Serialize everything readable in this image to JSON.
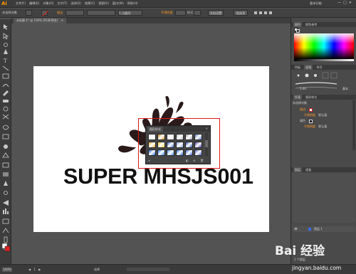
{
  "app": {
    "logo": "Ai",
    "menus": [
      "文件(F)",
      "编辑(E)",
      "对象(O)",
      "文字(T)",
      "选择(S)",
      "效果(C)",
      "视图(V)",
      "窗口(W)",
      "帮助(H)"
    ],
    "workspace": "基本功能",
    "window_controls": [
      "—",
      "□",
      "✕"
    ]
  },
  "control_bar": {
    "selection_label": "未选择对象",
    "stroke_label": "描边",
    "opacity_label": "不透明度",
    "style_label": "样式",
    "doc_setup_button": "文档设置",
    "preferences_button": "首选项",
    "brush_value": "5 点圆形"
  },
  "document_tab": {
    "title": "未标题-1* @ 100% (RGB/预览)",
    "close": "✕"
  },
  "canvas": {
    "headline": "SUPER MHSJS001"
  },
  "graphic_styles_panel": {
    "tab": "图形样式",
    "swatch_colors": [
      "#f2f2f2",
      "#cf8a1a",
      "#e6e6e6",
      "#b8c0c8",
      "#9aa3ad",
      "#5b7fc9",
      "#e6a92a",
      "#ffcc33",
      "#3a62c2",
      "#8aa6e6",
      "#2a4ea8",
      "#4a3fa8",
      "#1f5fd6",
      "#2e7be3",
      "#4b8ff0",
      "#2a6ad6",
      "#3a5fcf",
      "#5060d0"
    ],
    "bottom_icons": [
      "≡",
      "◧",
      "⊕",
      "🗑"
    ]
  },
  "right_dock": {
    "color_header": [
      "颜色",
      "颜色参考"
    ],
    "brush_header": [
      "色板",
      "画笔",
      "符号"
    ],
    "stroke_value": "5.00",
    "brush_type": "基本",
    "appearance_header": [
      "外观",
      "图形样式"
    ],
    "appearance_title": "未选择对象",
    "appearance_rows": [
      {
        "label": "描边",
        "value": ""
      },
      {
        "label": "不透明度",
        "value": "默认值"
      },
      {
        "label": "填色",
        "value": ""
      },
      {
        "label": "不透明度",
        "value": "默认值"
      }
    ],
    "layers_header": [
      "图层",
      "画板"
    ],
    "layer_name": "图层 1",
    "layers_footer": "1 个图层"
  },
  "status_bar": {
    "zoom": "100%",
    "page": "1",
    "mode": "选择"
  },
  "watermark": {
    "text": "Bai 经验",
    "url": "jingyan.baidu.com"
  },
  "colors": {
    "accent_orange": "#ff9a00",
    "highlight_red": "#e01a1a",
    "ui_dark": "#3c3c3c",
    "ui_mid": "#535353"
  }
}
